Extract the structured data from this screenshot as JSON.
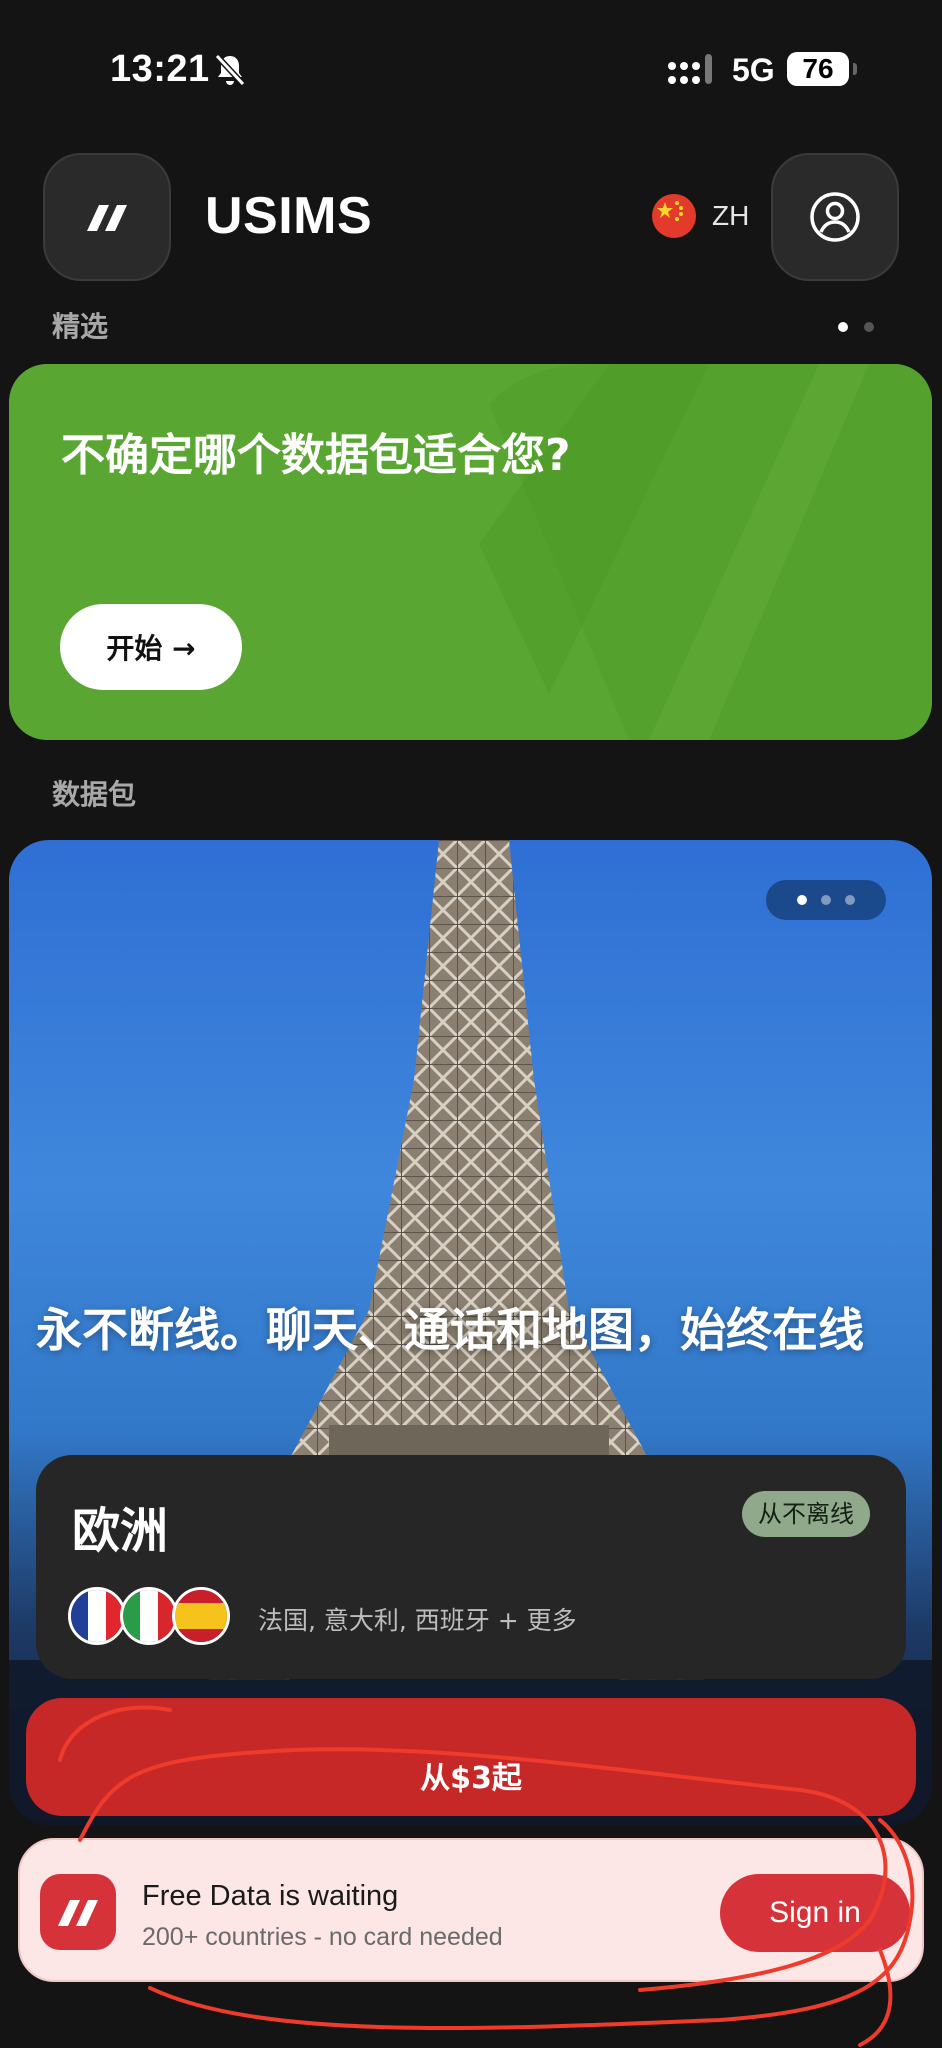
{
  "status_bar": {
    "time": "13:21",
    "network": "5G",
    "battery": "76"
  },
  "header": {
    "app_title": "USIMS",
    "language": "ZH"
  },
  "featured": {
    "section_label": "精选",
    "promo_title": "不确定哪个数据包适合您?",
    "start_label": "开始 →"
  },
  "packages": {
    "section_label": "数据包",
    "tagline": "永不断线。聊天、通话和地图，始终在线",
    "region": "欧洲",
    "badge": "从不离线",
    "countries": "法国, 意大利, 西班牙 + 更多",
    "price_label": "从$3起"
  },
  "banner": {
    "title": "Free Data is waiting",
    "subtitle": "200+ countries - no card needed",
    "signin_label": "Sign in"
  },
  "colors": {
    "accent_green": "#5aa632",
    "accent_red": "#d6323a",
    "background": "#141414"
  },
  "icons": [
    "bell-muted-icon",
    "signal-icon",
    "battery-icon",
    "logo-icon",
    "flag-cn-icon",
    "profile-icon",
    "arrow-right-icon",
    "flag-fr-icon",
    "flag-it-icon",
    "flag-es-icon"
  ]
}
